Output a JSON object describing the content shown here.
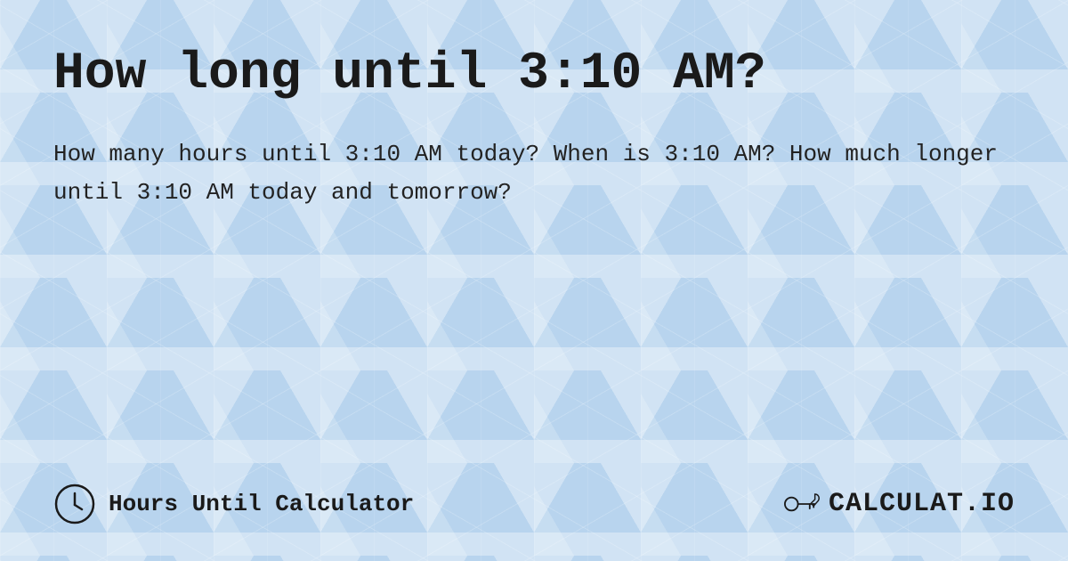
{
  "page": {
    "title": "How long until 3:10 AM?",
    "description": "How many hours until 3:10 AM today? When is 3:10 AM? How much longer until 3:10 AM today and tomorrow?",
    "footer": {
      "site_label": "Hours Until Calculator",
      "logo_text": "CALCULAT.IO"
    },
    "background_color": "#b8d4ee"
  }
}
